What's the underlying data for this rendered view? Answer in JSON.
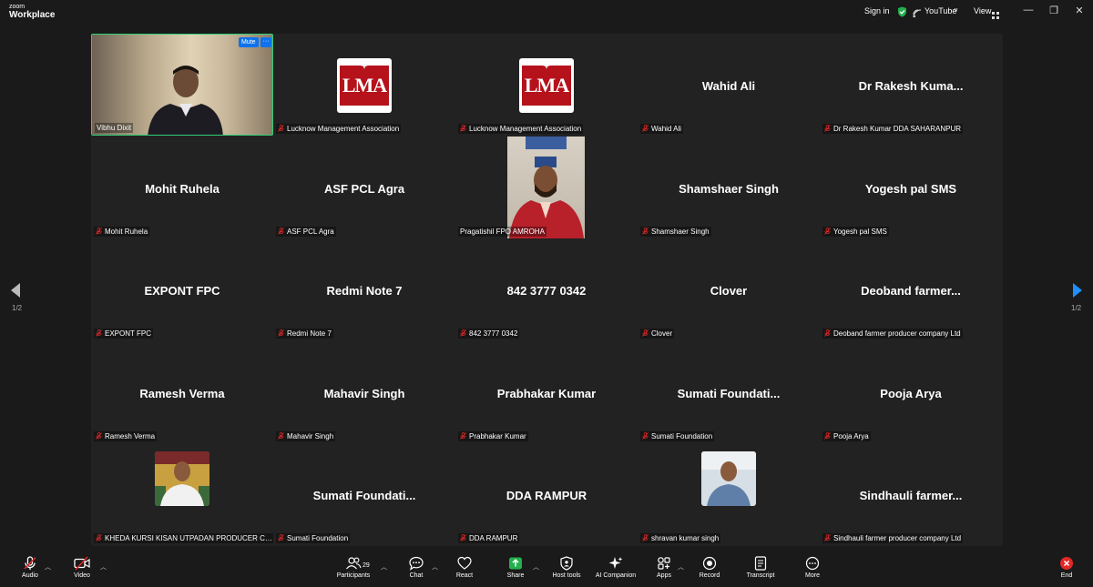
{
  "app": {
    "brand_small": "zoom",
    "brand_large": "Workplace"
  },
  "topbar": {
    "sign_in": "Sign in",
    "youtube": "YouTube",
    "view": "View"
  },
  "pagination": {
    "left": "1/2",
    "right": "1/2"
  },
  "self_view": {
    "name": "Vibhu Dixit",
    "mute_label": "Mute",
    "more_label": "···"
  },
  "tiles": [
    {
      "display": "",
      "label": "Lucknow Management Association",
      "type": "logo",
      "logo_text": "LMA"
    },
    {
      "display": "",
      "label": "Lucknow Management Association",
      "type": "logo",
      "logo_text": "LMA"
    },
    {
      "display": "Wahid Ali",
      "label": "Wahid Ali",
      "type": "name"
    },
    {
      "display": "Dr Rakesh Kuma...",
      "label": "Dr Rakesh Kumar DDA SAHARANPUR",
      "type": "name"
    },
    {
      "display": "Mohit Ruhela",
      "label": "Mohit Ruhela",
      "type": "name"
    },
    {
      "display": "ASF PCL Agra",
      "label": "ASF PCL Agra",
      "type": "name"
    },
    {
      "display": "",
      "label": "Pragatishil FPO AMROHA",
      "type": "video"
    },
    {
      "display": "Shamshaer Singh",
      "label": "Shamshaer Singh",
      "type": "name"
    },
    {
      "display": "Yogesh pal SMS",
      "label": "Yogesh pal SMS",
      "type": "name"
    },
    {
      "display": "EXPONT FPC",
      "label": "EXPONT FPC",
      "type": "name"
    },
    {
      "display": "Redmi Note 7",
      "label": "Redmi Note 7",
      "type": "name"
    },
    {
      "display": "842 3777 0342",
      "label": "842 3777 0342",
      "type": "name"
    },
    {
      "display": "Clover",
      "label": "Clover",
      "type": "name"
    },
    {
      "display": "Deoband  farmer...",
      "label": "Deoband farmer producer company Ltd",
      "type": "name"
    },
    {
      "display": "Ramesh Verma",
      "label": "Ramesh Verma",
      "type": "name"
    },
    {
      "display": "Mahavir Singh",
      "label": "Mahavir Singh",
      "type": "name"
    },
    {
      "display": "Prabhakar Kumar",
      "label": "Prabhakar Kumar",
      "type": "name"
    },
    {
      "display": "Sumati  Foundati...",
      "label": "Sumati Foundation",
      "type": "name"
    },
    {
      "display": "Pooja Arya",
      "label": "Pooja Arya",
      "type": "name"
    },
    {
      "display": "",
      "label": "KHEDA KURSI KISAN UTPADAN PRODUCER COM...",
      "type": "avatar"
    },
    {
      "display": "Sumati  Foundati...",
      "label": "Sumati Foundation",
      "type": "name"
    },
    {
      "display": "DDA RAMPUR",
      "label": "DDA RAMPUR",
      "type": "name"
    },
    {
      "display": "",
      "label": "shravan kumar singh",
      "type": "avatar"
    },
    {
      "display": "Sindhauli  farmer...",
      "label": "Sindhauli farmer producer company Ltd",
      "type": "name"
    }
  ],
  "toolbar": {
    "audio": "Audio",
    "video": "Video",
    "participants": "Participants",
    "participants_count": "29",
    "chat": "Chat",
    "react": "React",
    "share": "Share",
    "host_tools": "Host tools",
    "ai_companion": "AI Companion",
    "apps": "Apps",
    "record": "Record",
    "transcript": "Transcript",
    "more": "More",
    "end": "End"
  },
  "colors": {
    "accent": "#0e72ed",
    "active_speaker": "#2fd078",
    "mute_red": "#e02828",
    "share_green": "#22b14c",
    "end_red": "#e02828",
    "lma_red": "#b5121b"
  }
}
